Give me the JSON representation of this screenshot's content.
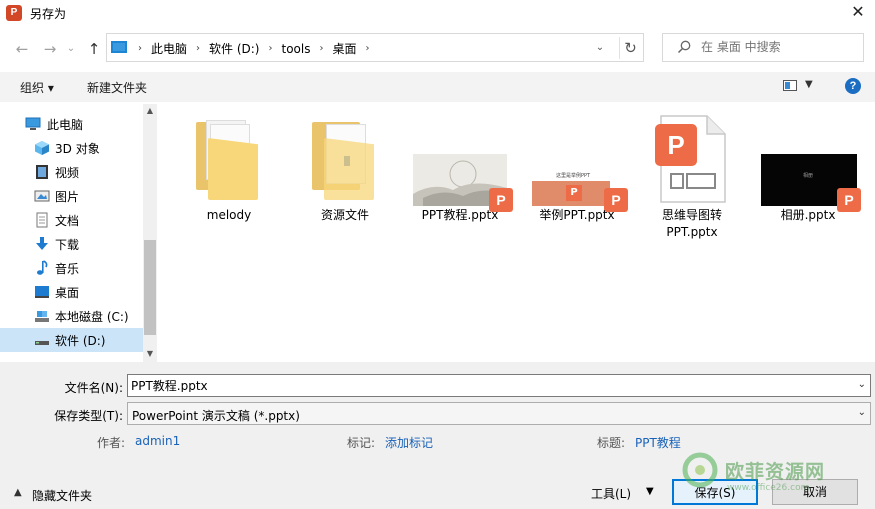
{
  "window": {
    "title": "另存为",
    "close": "✕"
  },
  "address": {
    "crumbs": [
      "此电脑",
      "软件 (D:)",
      "tools",
      "桌面"
    ]
  },
  "search": {
    "placeholder": "在 桌面 中搜索"
  },
  "toolbar": {
    "organize": "组织 ▾",
    "new_folder": "新建文件夹"
  },
  "sidebar": {
    "items": [
      {
        "label": "此电脑",
        "icon": "pc-icon"
      },
      {
        "label": "3D 对象",
        "icon": "cube-icon"
      },
      {
        "label": "视频",
        "icon": "video-icon"
      },
      {
        "label": "图片",
        "icon": "picture-icon"
      },
      {
        "label": "文档",
        "icon": "document-icon"
      },
      {
        "label": "下载",
        "icon": "download-icon"
      },
      {
        "label": "音乐",
        "icon": "music-icon"
      },
      {
        "label": "桌面",
        "icon": "desktop-icon"
      },
      {
        "label": "本地磁盘 (C:)",
        "icon": "drive-icon"
      },
      {
        "label": "软件 (D:)",
        "icon": "drive-icon"
      }
    ],
    "selected_index": 9
  },
  "files": [
    {
      "name": "melody",
      "type": "folder"
    },
    {
      "name": "资源文件",
      "type": "folder"
    },
    {
      "name": "PPT教程.pptx",
      "type": "pptx"
    },
    {
      "name": "举例PPT.pptx",
      "type": "pptx",
      "thumb_text": "这里是举例PPT"
    },
    {
      "name_line1": "思维导图转",
      "name_line2": "PPT.pptx",
      "type": "pptx-blank"
    },
    {
      "name": "相册.pptx",
      "type": "pptx",
      "thumb_text": "相册"
    }
  ],
  "form": {
    "filename_label": "文件名(N):",
    "filename_value": "PPT教程.pptx",
    "filetype_label": "保存类型(T):",
    "filetype_value": "PowerPoint 演示文稿 (*.pptx)",
    "author_label": "作者:",
    "author_value": "admin1",
    "tags_label": "标记:",
    "tags_value": "添加标记",
    "title_label": "标题:",
    "title_value": "PPT教程"
  },
  "footer": {
    "hide_folders": "隐藏文件夹",
    "tools": "工具(L)",
    "save": "保存(S)",
    "cancel": "取消"
  },
  "watermark": {
    "brand": "欧菲资源网",
    "url": "www.office26.com"
  },
  "colors": {
    "accent": "#0078d7",
    "ppt_orange": "#ed6c47",
    "selected_bg": "#cce4f7"
  }
}
